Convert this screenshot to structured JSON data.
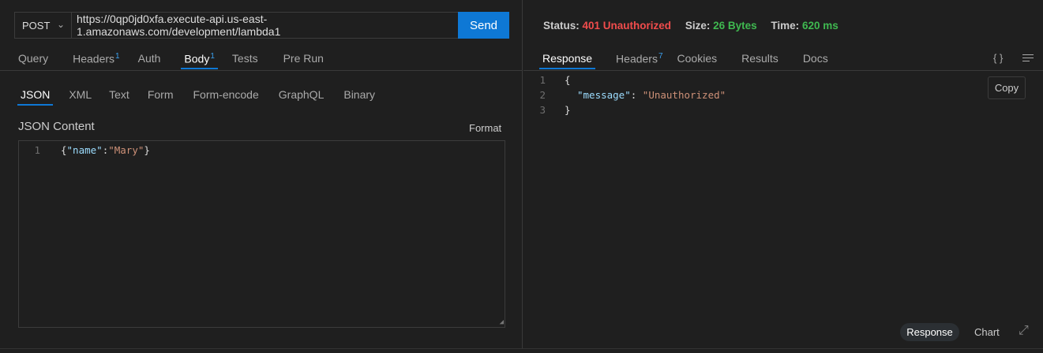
{
  "request": {
    "method": "POST",
    "url": "https://0qp0jd0xfa.execute-api.us-east-1.amazonaws.com/development/lambda1",
    "send_label": "Send",
    "tabs": [
      {
        "label": "Query"
      },
      {
        "label": "Headers",
        "badge": "1"
      },
      {
        "label": "Auth"
      },
      {
        "label": "Body",
        "badge": "1",
        "active": true
      },
      {
        "label": "Tests"
      },
      {
        "label": "Pre Run"
      }
    ],
    "body_tabs": [
      {
        "label": "JSON",
        "active": true
      },
      {
        "label": "XML"
      },
      {
        "label": "Text"
      },
      {
        "label": "Form"
      },
      {
        "label": "Form-encode"
      },
      {
        "label": "GraphQL"
      },
      {
        "label": "Binary"
      }
    ],
    "content_label": "JSON Content",
    "format_label": "Format",
    "editor": {
      "line": "1",
      "open": "{",
      "key": "\"name\"",
      "colon": ":",
      "value": "\"Mary\"",
      "close": "}"
    }
  },
  "response": {
    "status_label": "Status:",
    "status_value": "401 Unauthorized",
    "status_color": "#f14c4c",
    "size_label": "Size:",
    "size_value": "26 Bytes",
    "time_label": "Time:",
    "time_value": "620 ms",
    "ok_color": "#3fb950",
    "tabs": [
      {
        "label": "Response",
        "active": true
      },
      {
        "label": "Headers",
        "badge": "7"
      },
      {
        "label": "Cookies"
      },
      {
        "label": "Results"
      },
      {
        "label": "Docs"
      }
    ],
    "braces_icon": "{ }",
    "lines": [
      {
        "n": "1",
        "text": "{"
      },
      {
        "n": "2",
        "key": "\"message\"",
        "colon": ": ",
        "value": "\"Unauthorized\""
      },
      {
        "n": "3",
        "text": "}"
      }
    ],
    "copy_label": "Copy",
    "view_response": "Response",
    "view_chart": "Chart"
  }
}
